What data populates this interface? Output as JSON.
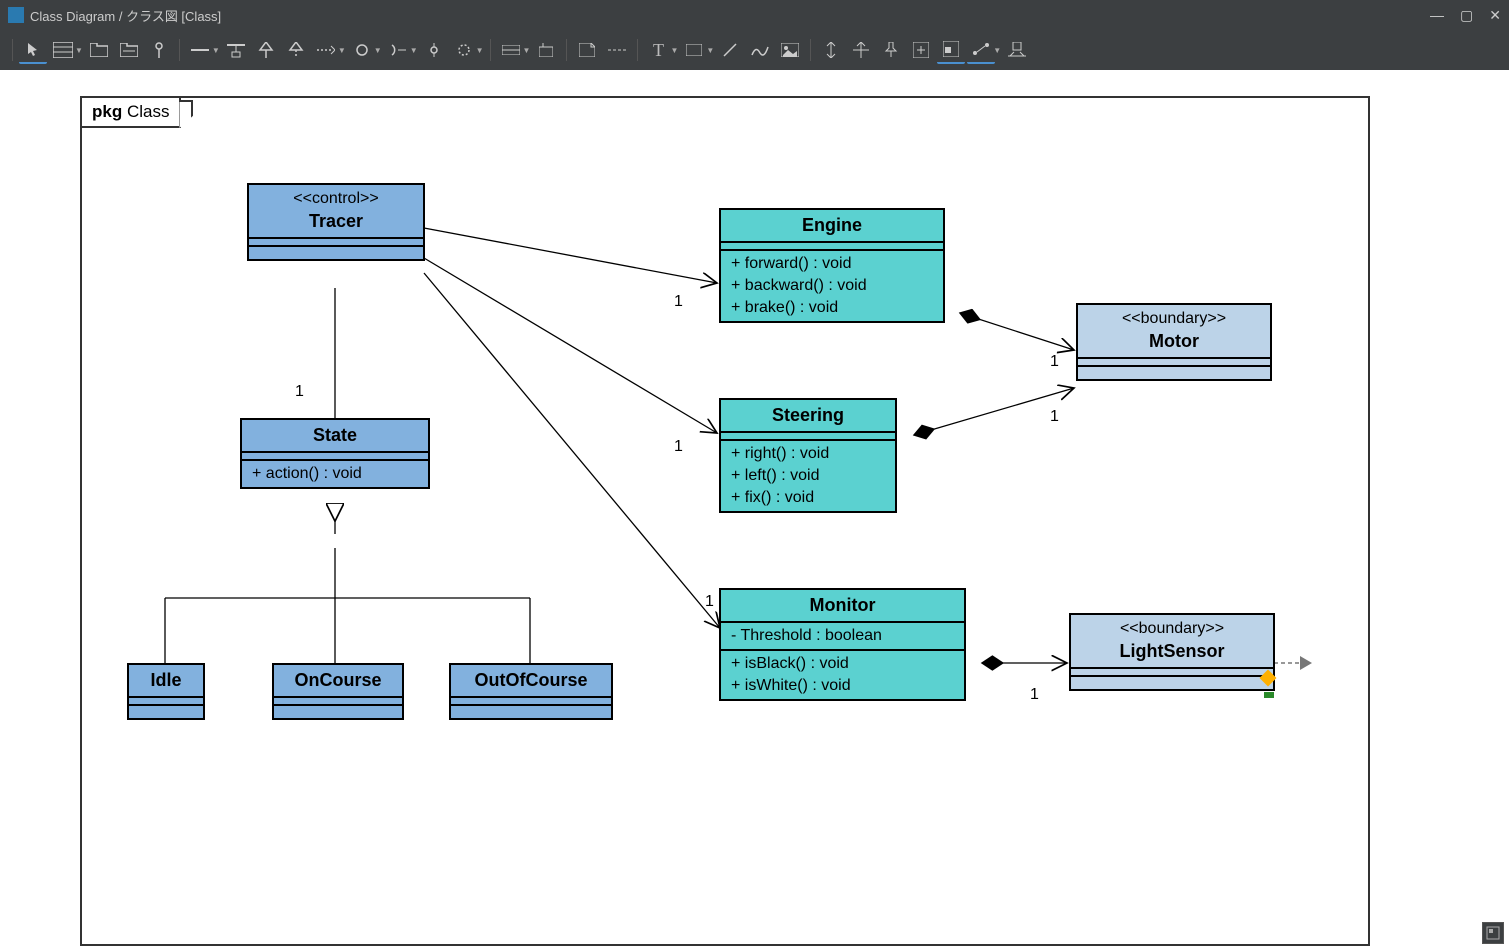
{
  "window": {
    "title": "Class Diagram / クラス図 [Class]"
  },
  "frame": {
    "pkg_prefix": "pkg",
    "pkg_name": "Class"
  },
  "classes": {
    "tracer": {
      "stereo": "<<control>>",
      "name": "Tracer"
    },
    "state": {
      "name": "State",
      "ops": [
        "+ action() : void"
      ]
    },
    "idle": {
      "name": "Idle"
    },
    "oncourse": {
      "name": "OnCourse"
    },
    "outofcourse": {
      "name": "OutOfCourse"
    },
    "engine": {
      "name": "Engine",
      "ops": [
        "+ forward() : void",
        "+ backward() : void",
        "+ brake() : void"
      ]
    },
    "steering": {
      "name": "Steering",
      "ops": [
        "+ right() : void",
        "+ left() : void",
        "+ fix() : void"
      ]
    },
    "monitor": {
      "name": "Monitor",
      "attrs": [
        "- Threshold : boolean"
      ],
      "ops": [
        "+ isBlack() : void",
        "+ isWhite() : void"
      ]
    },
    "motor": {
      "stereo": "<<boundary>>",
      "name": "Motor"
    },
    "lightsensor": {
      "stereo": "<<boundary>>",
      "name": "LightSensor"
    }
  },
  "mult": {
    "one": "1"
  }
}
